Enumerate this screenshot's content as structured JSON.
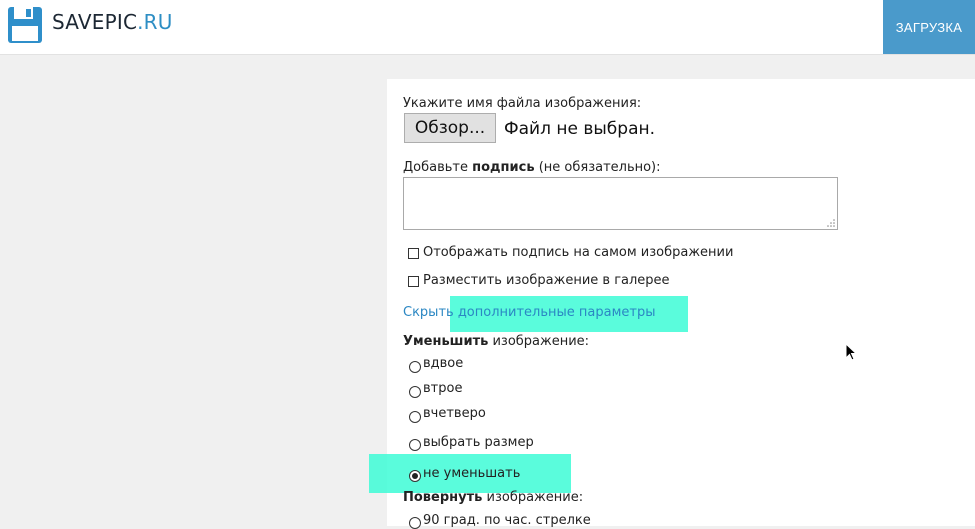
{
  "header": {
    "logo_name": "SAVEPIC",
    "logo_tld": ".RU",
    "upload_label": "ЗАГРУЗКА"
  },
  "form": {
    "file_prompt": "Укажите имя файла изображения:",
    "browse_label": "Обзор...",
    "file_status": "Файл не выбран.",
    "caption_prefix": "Добавьте ",
    "caption_bold": "подпись",
    "caption_suffix": " (не обязательно):",
    "caption_value": "",
    "show_caption_label": "Отображать подпись на самом изображении",
    "gallery_label": "Разместить изображение в галерее",
    "toggle_hide": "Скрыть",
    "toggle_rest": " дополнительные параметры",
    "reduce_bold": "Уменьшить",
    "reduce_suffix": " изображение:",
    "reduce_options": [
      "вдвое",
      "втрое",
      "вчетверо",
      "выбрать размер",
      "не уменьшать"
    ],
    "reduce_selected": "не уменьшать",
    "rotate_bold": "Повернуть",
    "rotate_suffix": " изображение:",
    "rotate_first_option": "90 град. по час. стрелке"
  },
  "colors": {
    "accent": "#4a9acb",
    "link": "#2b87c3",
    "highlight": "#3dfcd6"
  }
}
